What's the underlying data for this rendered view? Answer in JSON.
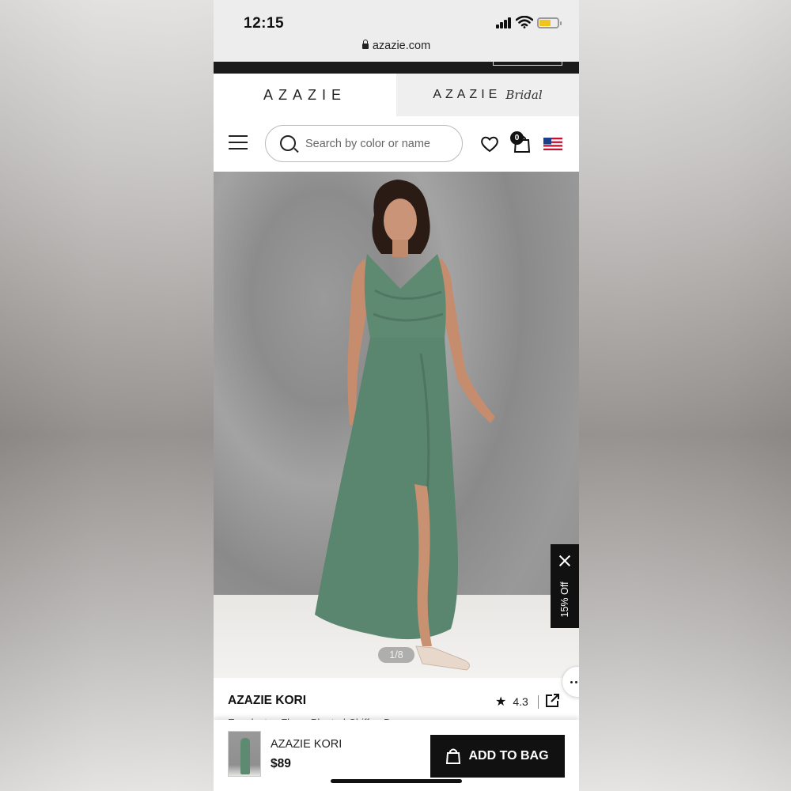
{
  "status_bar": {
    "time": "12:15",
    "url": "azazie.com"
  },
  "brand_tabs": {
    "main": "AZAZIE",
    "bridal_prefix": "AZAZIE",
    "bridal_script": "Bridal"
  },
  "search": {
    "placeholder": "Search by color or name"
  },
  "cart": {
    "count": "0"
  },
  "gallery": {
    "counter": "1/8"
  },
  "promo": {
    "label": "15% Off"
  },
  "product": {
    "name": "AZAZIE KORI",
    "subtitle": "Eucalyptus Flowy Pleated Chiffon Dress",
    "rating": "4.3"
  },
  "sticky_bar": {
    "name": "AZAZIE KORI",
    "price": "$89",
    "button_label": "ADD TO BAG"
  },
  "colors": {
    "dress": "#5e8a72",
    "accent_dark": "#111111",
    "battery": "#f0c419"
  }
}
